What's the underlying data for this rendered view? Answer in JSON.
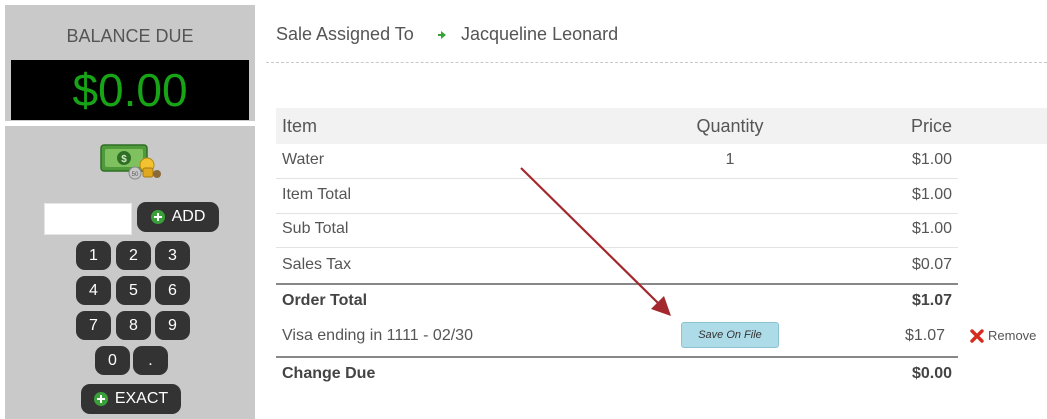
{
  "balance": {
    "label": "BALANCE DUE",
    "amount": "$0.00"
  },
  "keypad": {
    "input_value": "",
    "add_label": "ADD",
    "keys": [
      "1",
      "2",
      "3",
      "4",
      "5",
      "6",
      "7",
      "8",
      "9",
      "0",
      "."
    ],
    "exact_label": "EXACT"
  },
  "sale": {
    "assigned_label": "Sale Assigned To",
    "assigned_name": "Jacqueline Leonard"
  },
  "table": {
    "headers": {
      "item": "Item",
      "quantity": "Quantity",
      "price": "Price"
    },
    "items": [
      {
        "name": "Water",
        "quantity": "1",
        "price": "$1.00"
      }
    ],
    "item_total": {
      "label": "Item Total",
      "value": "$1.00"
    },
    "sub_total": {
      "label": "Sub Total",
      "value": "$1.00"
    },
    "sales_tax": {
      "label": "Sales Tax",
      "value": "$0.07"
    },
    "order_total": {
      "label": "Order Total",
      "value": "$1.07"
    },
    "payment": {
      "label": "Visa ending in 1111 - 02/30",
      "save_label": "Save On File",
      "value": "$1.07",
      "remove_label": "Remove"
    },
    "change_due": {
      "label": "Change Due",
      "value": "$0.00"
    }
  },
  "colors": {
    "display_text": "#17a417",
    "annotation_arrow": "#a3282e",
    "save_button": "#aedbe8"
  }
}
